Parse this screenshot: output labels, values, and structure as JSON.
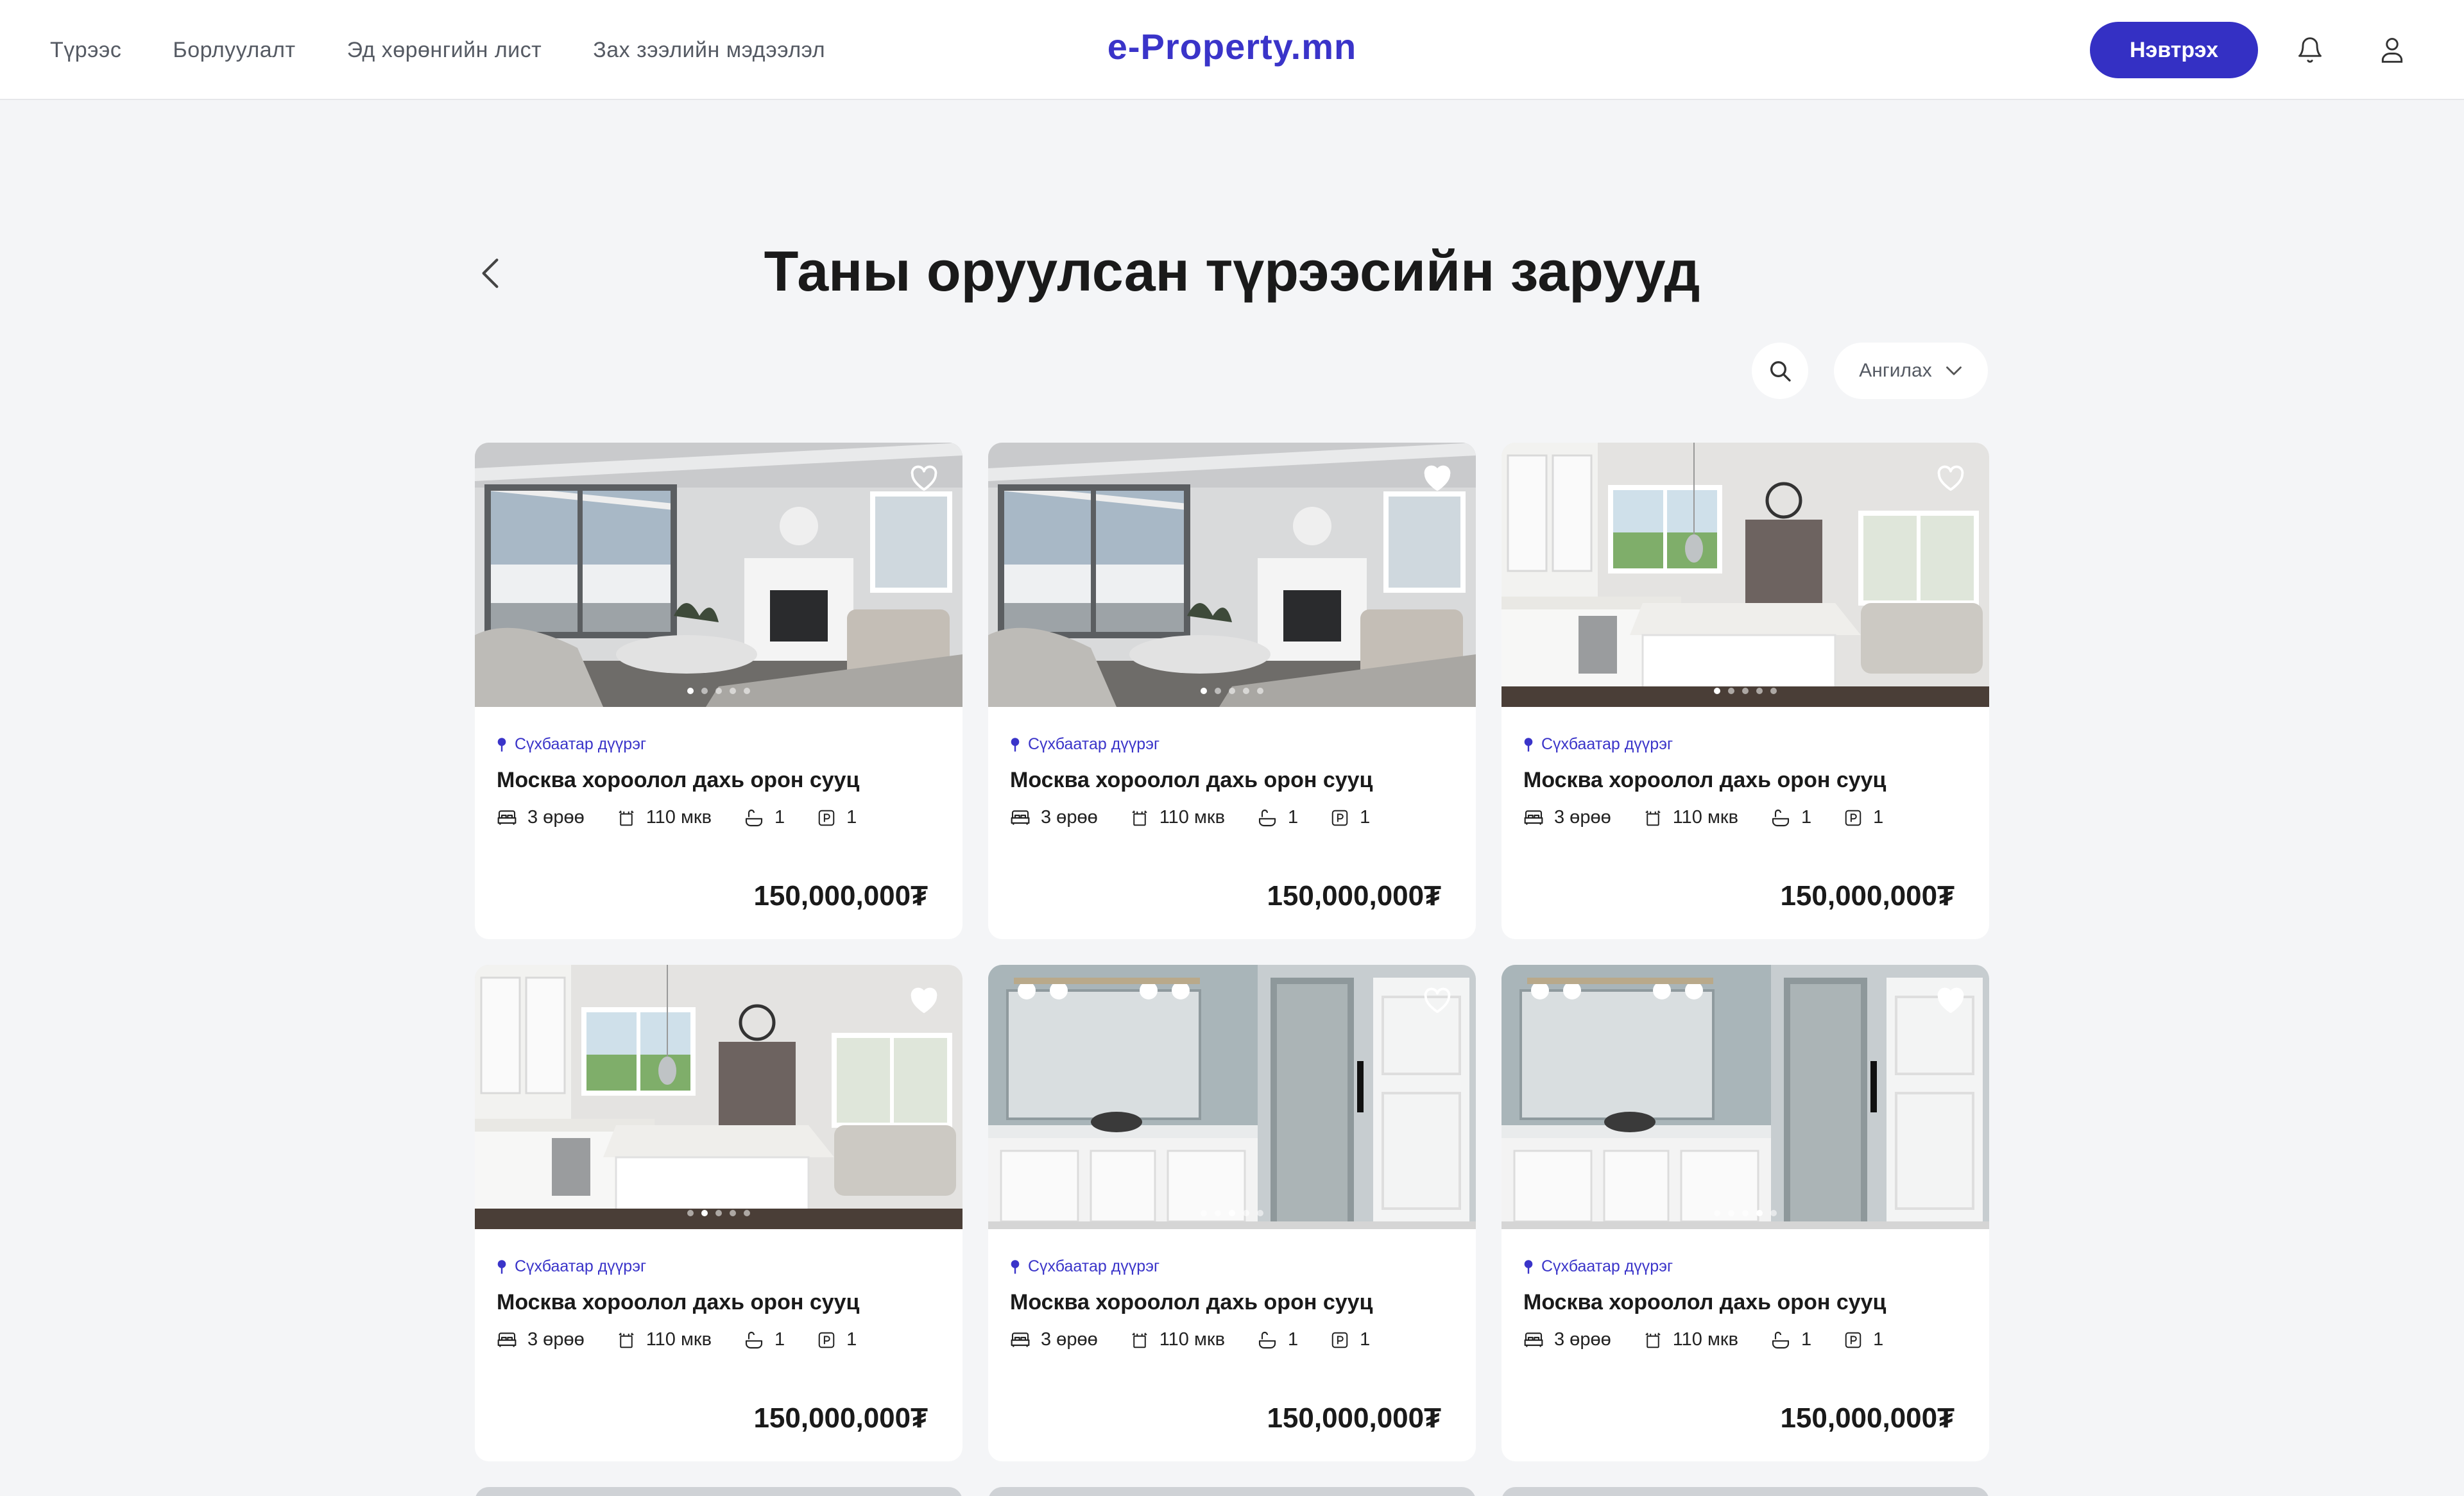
{
  "nav": {
    "items": [
      "Түрээс",
      "Борлуулалт",
      "Эд хөрөнгийн лист",
      "Зах зээлийн мэдээлэл"
    ],
    "logo": "e-Property.mn",
    "login_label": "Нэвтрэх",
    "icons": [
      "bell-icon",
      "user-icon"
    ]
  },
  "page": {
    "title": "Таны оруулсан түрээсийн зарууд",
    "sort_label": "Ангилах"
  },
  "colors": {
    "accent": "#3430c4",
    "background": "#f4f5f7"
  },
  "listings": [
    {
      "district": "Сүхбаатар дүүрэг",
      "title": "Москва хороолол дахь орон сууц",
      "rooms": "3 өрөө",
      "area": "110 мкв",
      "baths": "1",
      "parking": "1",
      "price": "150,000,000₮",
      "favorite": false,
      "photo": "living-room",
      "slide": 1,
      "slides": 5
    },
    {
      "district": "Сүхбаатар дүүрэг",
      "title": "Москва хороолол дахь орон сууц",
      "rooms": "3 өрөө",
      "area": "110 мкв",
      "baths": "1",
      "parking": "1",
      "price": "150,000,000₮",
      "favorite": true,
      "photo": "living-room",
      "slide": 1,
      "slides": 5
    },
    {
      "district": "Сүхбаатар дүүрэг",
      "title": "Москва хороолол дахь орон сууц",
      "rooms": "3 өрөө",
      "area": "110 мкв",
      "baths": "1",
      "parking": "1",
      "price": "150,000,000₮",
      "favorite": false,
      "photo": "kitchen",
      "slide": 1,
      "slides": 5
    },
    {
      "district": "Сүхбаатар дүүрэг",
      "title": "Москва хороолол дахь орон сууц",
      "rooms": "3 өрөө",
      "area": "110 мкв",
      "baths": "1",
      "parking": "1",
      "price": "150,000,000₮",
      "favorite": true,
      "photo": "kitchen",
      "slide": 2,
      "slides": 5
    },
    {
      "district": "Сүхбаатар дүүрэг",
      "title": "Москва хороолол дахь орон сууц",
      "rooms": "3 өрөө",
      "area": "110 мкв",
      "baths": "1",
      "parking": "1",
      "price": "150,000,000₮",
      "favorite": false,
      "photo": "bathroom",
      "slide": 3,
      "slides": 5
    },
    {
      "district": "Сүхбаатар дүүрэг",
      "title": "Москва хороолол дахь орон сууц",
      "rooms": "3 өрөө",
      "area": "110 мкв",
      "baths": "1",
      "parking": "1",
      "price": "150,000,000₮",
      "favorite": true,
      "photo": "bathroom",
      "slide": 4,
      "slides": 5
    }
  ]
}
